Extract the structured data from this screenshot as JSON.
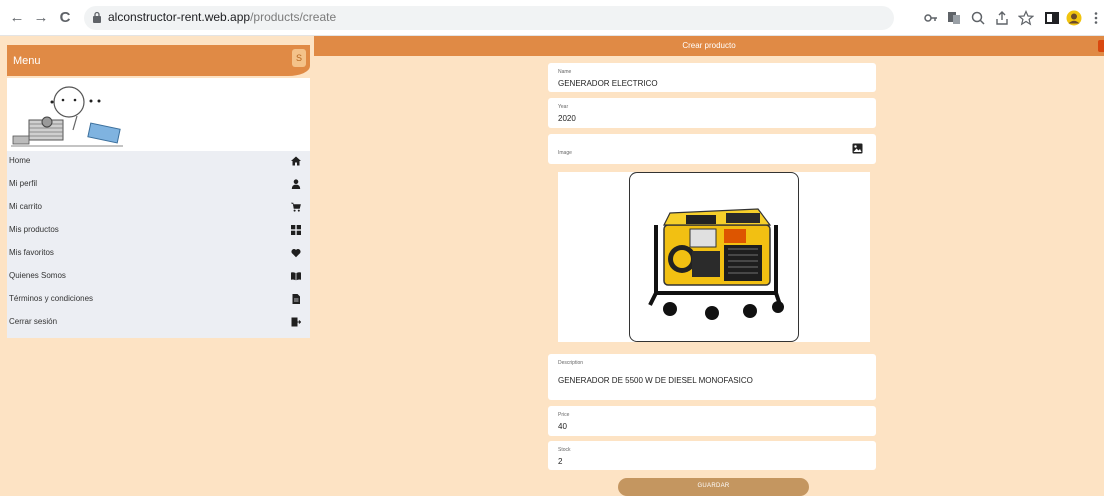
{
  "browser": {
    "url_domain": "alconstructor-rent.web.app",
    "url_path": "/products/create",
    "back_label": "←",
    "forward_label": "→",
    "reload_label": "C"
  },
  "sidebar": {
    "title": "Menu",
    "brand_mark": "S",
    "items": [
      {
        "label": "Home",
        "icon": "home-icon"
      },
      {
        "label": "Mi perfil",
        "icon": "person-icon"
      },
      {
        "label": "Mi carrito",
        "icon": "cart-icon"
      },
      {
        "label": "Mis productos",
        "icon": "grid-icon"
      },
      {
        "label": "Mis favoritos",
        "icon": "heart-icon"
      },
      {
        "label": "Quienes Somos",
        "icon": "book-icon"
      },
      {
        "label": "Términos y condiciones",
        "icon": "document-icon"
      },
      {
        "label": "Cerrar sesión",
        "icon": "logout-icon"
      }
    ]
  },
  "main": {
    "title": "Crear producto",
    "fields": {
      "name": {
        "label": "Name",
        "value": "GENERADOR ELECTRICO"
      },
      "year": {
        "label": "Year",
        "value": "2020"
      },
      "image": {
        "label": "Image"
      },
      "description": {
        "label": "Description",
        "value": "GENERADOR DE 5500 W DE DIESEL MONOFASICO"
      },
      "price": {
        "label": "Price",
        "value": "40"
      },
      "stock": {
        "label": "Stock",
        "value": "2"
      }
    },
    "save_label": "GUARDAR"
  },
  "colors": {
    "accent": "#e08a45",
    "page_background": "#fde3c4",
    "button": "#c49660"
  }
}
